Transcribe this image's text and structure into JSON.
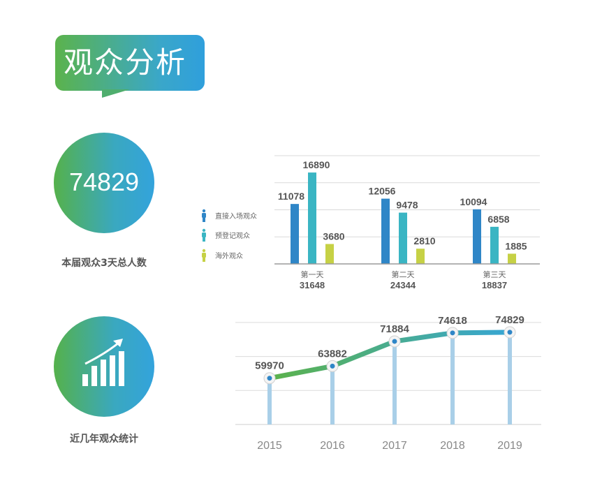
{
  "title": "观众分析",
  "total": {
    "value": "74829",
    "caption": "本届观众3天总人数"
  },
  "trend_caption": "近几年观众统计",
  "colors": {
    "direct": "#2f86c7",
    "prereg": "#3ab5c3",
    "outside": "#c6d145",
    "line": "#55ae6a"
  },
  "chart_data": [
    {
      "type": "bar",
      "categories": [
        "第一天",
        "第二天",
        "第三天"
      ],
      "category_totals": [
        "31648",
        "24344",
        "18837"
      ],
      "series": [
        {
          "name": "直接入场观众",
          "values": [
            11078,
            12056,
            10094
          ]
        },
        {
          "name": "预登记观众",
          "values": [
            16890,
            9478,
            6858
          ]
        },
        {
          "name": "海外观众",
          "values": [
            3680,
            2810,
            1885
          ]
        }
      ],
      "ylim": [
        0,
        20000
      ],
      "legend": "left",
      "grid": true
    },
    {
      "type": "line",
      "x": [
        "2015",
        "2016",
        "2017",
        "2018",
        "2019"
      ],
      "values": [
        59970,
        63882,
        71884,
        74618,
        74829
      ],
      "ylim": [
        45000,
        80000
      ],
      "grid": true
    }
  ]
}
